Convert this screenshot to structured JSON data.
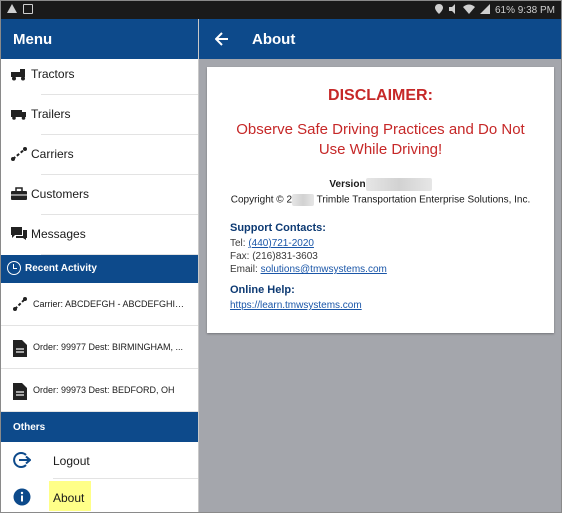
{
  "status_bar": {
    "text": "61% 9:38 PM"
  },
  "drawer": {
    "title": "Menu",
    "menu_items": [
      {
        "label": "Tractors",
        "icon": "tractor-icon"
      },
      {
        "label": "Trailers",
        "icon": "trailer-icon"
      },
      {
        "label": "Carriers",
        "icon": "carrier-icon"
      },
      {
        "label": "Customers",
        "icon": "customer-icon"
      },
      {
        "label": "Messages",
        "icon": "message-icon"
      }
    ],
    "recent_header": "Recent Activity",
    "recent_items": [
      {
        "label": "Carrier: ABCDEFGH - ABCDEFGHIJ...",
        "icon": "carrier-icon"
      },
      {
        "label": "Order: 99977 Dest: BIRMINGHAM, ...",
        "icon": "document-icon"
      },
      {
        "label": "Order: 99973 Dest: BEDFORD, OH",
        "icon": "document-icon"
      }
    ],
    "others_header": "Others",
    "others_items": [
      {
        "label": "Logout",
        "icon": "logout-icon"
      },
      {
        "label": "About",
        "icon": "info-icon"
      }
    ]
  },
  "main": {
    "title": "About",
    "disclaimer_title": "DISCLAIMER:",
    "disclaimer_text": "Observe Safe Driving Practices and Do Not Use While Driving!",
    "version_label": "Version",
    "copyright_prefix": "Copyright © 2",
    "copyright_suffix": "Trimble Transportation Enterprise Solutions, Inc.",
    "support_title": "Support Contacts:",
    "tel_label": "Tel: ",
    "tel_value": "(440)721-2020",
    "fax_line": "Fax: (216)831-3603",
    "email_label": "Email: ",
    "email_value": "solutions@tmwsystems.com",
    "online_help_title": "Online Help:",
    "online_help_url": "https://learn.tmwsystems.com"
  },
  "colors": {
    "brand_blue": "#0d4a8b",
    "disclaimer_red": "#c62828",
    "link_blue": "#1a56a8",
    "highlight_yellow": "#ffff88",
    "main_background": "#a4a6ac"
  }
}
